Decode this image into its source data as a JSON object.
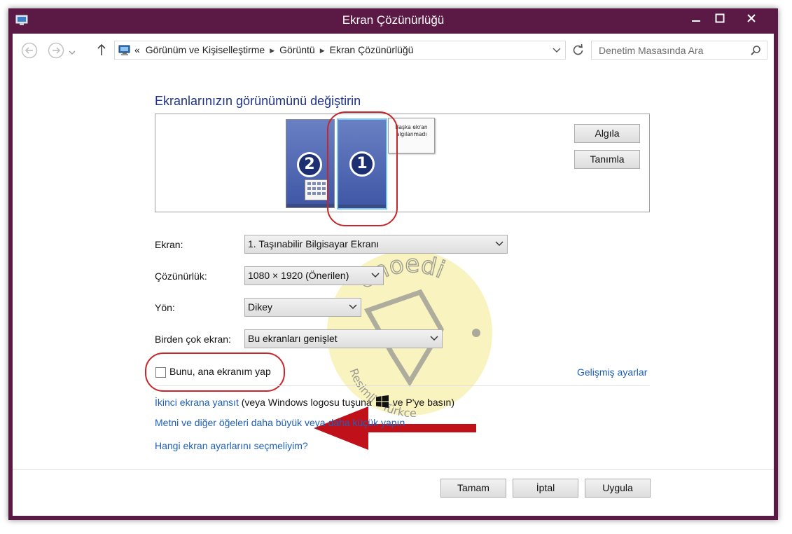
{
  "window": {
    "title": "Ekran Çözünürlüğü"
  },
  "address": {
    "overflow": "«",
    "crumbs": [
      "Görünüm ve Kişiselleştirme",
      "Görüntü",
      "Ekran Çözünürlüğü"
    ],
    "search_placeholder": "Denetim Masasında Ara"
  },
  "main": {
    "heading": "Ekranlarınızın görünümünü değiştirin",
    "monitors": [
      {
        "number": "2"
      },
      {
        "number": "1",
        "selected": true
      }
    ],
    "undetected_label": "Başka ekran algılanmadı",
    "detect_label": "Algıla",
    "identify_label": "Tanımla",
    "fields": {
      "display_label": "Ekran:",
      "display_value": "1. Taşınabilir Bilgisayar Ekranı",
      "resolution_label": "Çözünürlük:",
      "resolution_value": "1080 × 1920 (Önerilen)",
      "orientation_label": "Yön:",
      "orientation_value": "Dikey",
      "multiple_label": "Birden çok ekran:",
      "multiple_value": "Bu ekranları genişlet"
    },
    "checkbox_label": "Bunu, ana ekranım yap",
    "checkbox_checked": false,
    "advanced_link": "Gelişmiş ayarlar",
    "project_link": "İkinci ekrana yansıt",
    "project_hint_before": "(veya Windows logosu tuşuna",
    "project_hint_after": "ve P'ye basın)",
    "text_size_link": "Metni ve diğer öğeleri daha büyük veya daha küçük yapın",
    "which_settings_link": "Hangi ekran ayarlarını seçmeliyim?"
  },
  "footer": {
    "ok_label": "Tamam",
    "cancel_label": "İptal",
    "apply_label": "Uygula"
  },
  "watermark": {
    "brand": "enoedi",
    "tagline": "Resimli . Türkçe"
  },
  "colors": {
    "frame": "#5a1a45",
    "heading": "#1e3287",
    "link": "#1e5fb8",
    "highlight": "#c8262a"
  },
  "icons": [
    "control-panel-icon",
    "back-arrow-icon",
    "forward-arrow-icon",
    "up-arrow-icon",
    "refresh-icon",
    "search-icon",
    "windows-logo-icon"
  ]
}
